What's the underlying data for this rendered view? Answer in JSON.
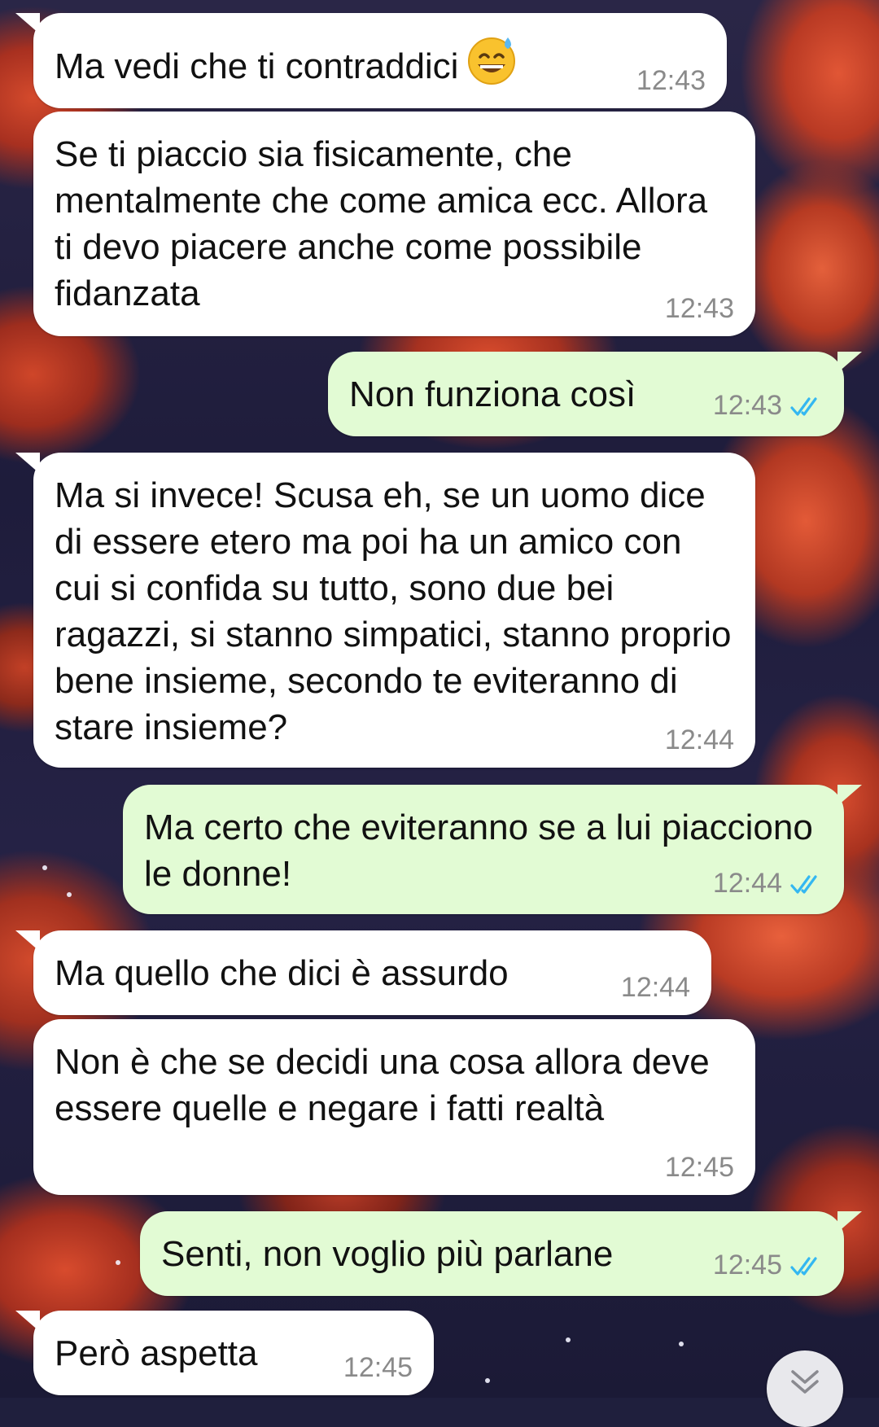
{
  "chat": {
    "messages": [
      {
        "direction": "incoming",
        "text": "Ma vedi che ti contraddici",
        "emoji": "grinning-face-with-sweat",
        "time": "12:43"
      },
      {
        "direction": "incoming",
        "text": "Se ti piaccio sia fisicamente, che mentalmente che come amica ecc. Allora ti devo piacere anche come possibile fidanzata",
        "time": "12:43"
      },
      {
        "direction": "outgoing",
        "text": "Non funziona così",
        "time": "12:43",
        "status": "read"
      },
      {
        "direction": "incoming",
        "text": "Ma si invece! Scusa eh, se un uomo dice di essere etero ma poi ha un amico con cui si confida su tutto, sono due bei ragazzi, si stanno simpatici, stanno proprio bene insieme, secondo te eviteranno di stare insieme?",
        "time": "12:44"
      },
      {
        "direction": "outgoing",
        "text": "Ma certo che eviteranno se a lui piacciono le donne!",
        "time": "12:44",
        "status": "read"
      },
      {
        "direction": "incoming",
        "text": "Ma quello che dici è assurdo",
        "time": "12:44"
      },
      {
        "direction": "incoming",
        "text": "Non è che se decidi una cosa allora deve essere quelle e negare i fatti realtà",
        "time": "12:45"
      },
      {
        "direction": "outgoing",
        "text": "Senti, non voglio più parlane",
        "time": "12:45",
        "status": "read"
      },
      {
        "direction": "incoming",
        "text": "Però aspetta",
        "time": "12:45"
      }
    ]
  },
  "colors": {
    "incoming_bubble": "#ffffff",
    "outgoing_bubble": "#e2fbd4",
    "read_ticks": "#34b7f1",
    "timestamp": "#8a8a8a"
  },
  "icons": {
    "read_receipt": "double-check-icon",
    "scroll_down": "chevron-double-down-icon"
  }
}
